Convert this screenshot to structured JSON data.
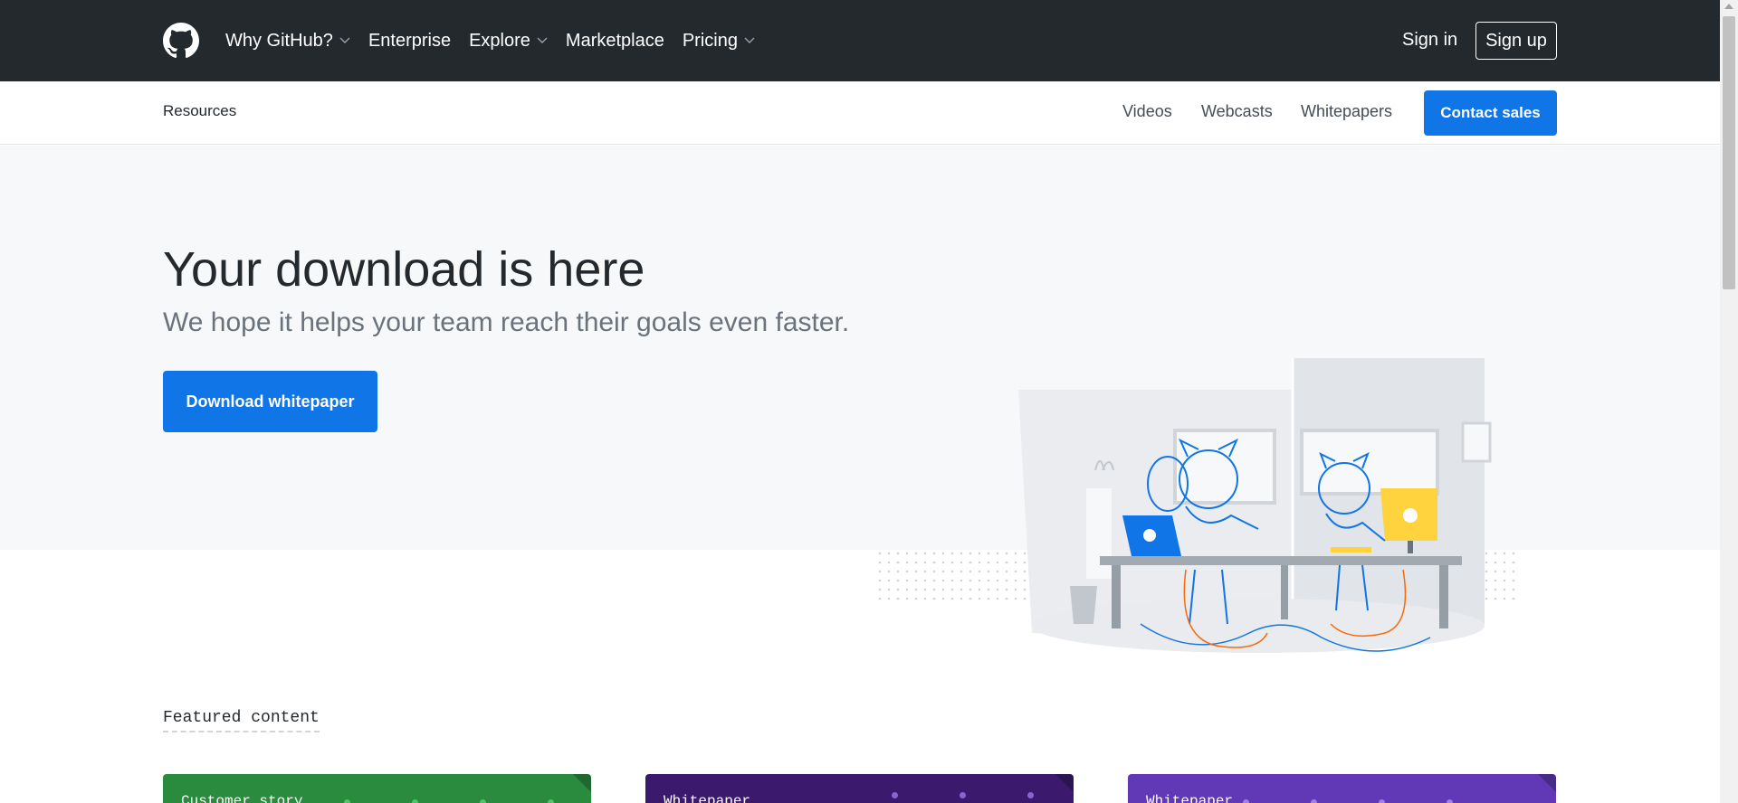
{
  "header": {
    "nav": [
      {
        "label": "Why GitHub?",
        "has_dropdown": true
      },
      {
        "label": "Enterprise",
        "has_dropdown": false
      },
      {
        "label": "Explore",
        "has_dropdown": true
      },
      {
        "label": "Marketplace",
        "has_dropdown": false
      },
      {
        "label": "Pricing",
        "has_dropdown": true
      }
    ],
    "sign_in": "Sign in",
    "sign_up": "Sign up"
  },
  "subnav": {
    "title": "Resources",
    "links": [
      "Videos",
      "Webcasts",
      "Whitepapers"
    ],
    "contact": "Contact sales"
  },
  "hero": {
    "title": "Your download is here",
    "subtitle": "We hope it helps your team reach their goals even faster.",
    "button": "Download whitepaper"
  },
  "featured": {
    "heading": "Featured content",
    "cards": [
      {
        "label": "Customer story",
        "color": "#2a8a3e"
      },
      {
        "label": "Whitepaper",
        "color": "#3b1a6e"
      },
      {
        "label": "Whitepaper",
        "color": "#6138b5"
      }
    ]
  },
  "colors": {
    "header_bg": "#24292e",
    "accent": "#1075e6",
    "hero_bg": "#f6f8fa"
  },
  "icons": [
    "github-logo-icon",
    "chevron-down-icon"
  ]
}
